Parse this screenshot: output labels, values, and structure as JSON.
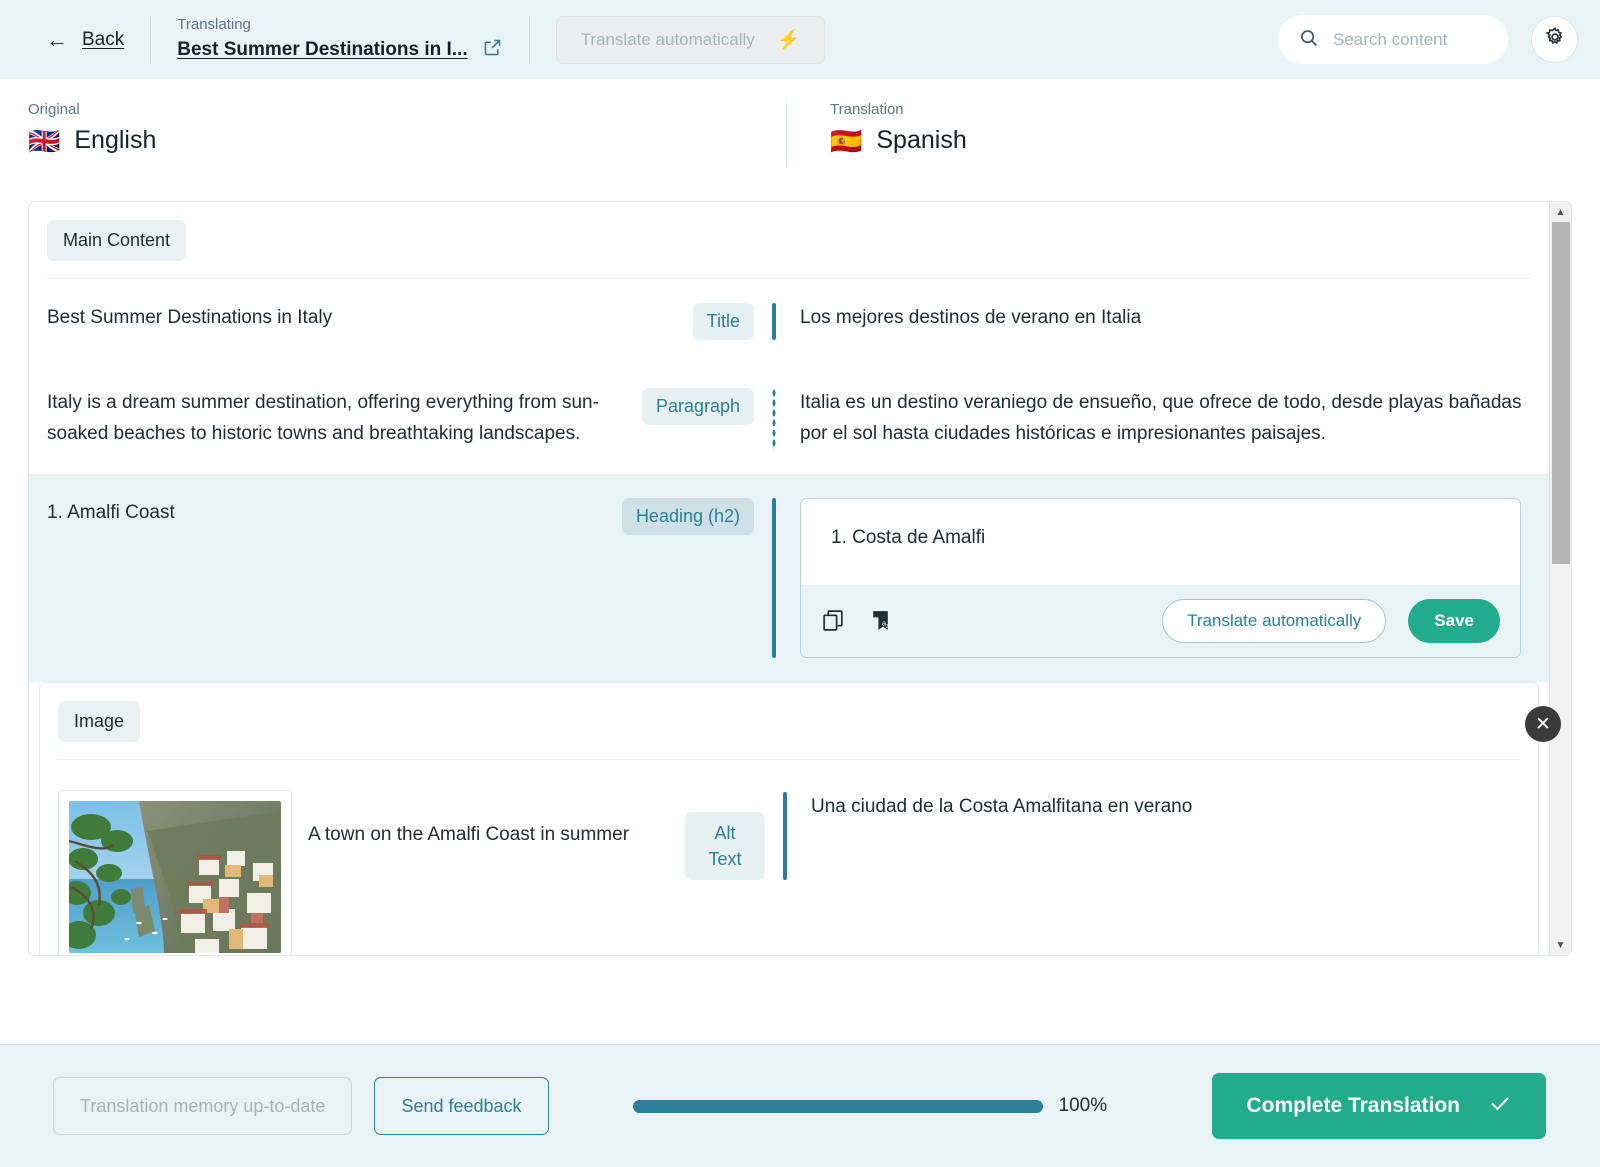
{
  "header": {
    "back_label": "Back",
    "translating_label": "Translating",
    "doc_title": "Best Summer Destinations in I...",
    "auto_translate_label": "Translate automatically",
    "search_placeholder": "Search content"
  },
  "languages": {
    "original_caption": "Original",
    "original_name": "English",
    "original_flag": "🇬🇧",
    "translation_caption": "Translation",
    "translation_name": "Spanish",
    "translation_flag": "🇪🇸"
  },
  "sections": [
    {
      "label": "Main Content"
    },
    {
      "label": "Image"
    }
  ],
  "rows": [
    {
      "source": "Best Summer Destinations in Italy",
      "badge": "Title",
      "target": "Los mejores destinos de verano en Italia"
    },
    {
      "source": "Italy is a dream summer destination, offering everything from sun-soaked beaches to historic towns and breathtaking landscapes.",
      "badge": "Paragraph",
      "target": "Italia es un destino veraniego de ensueño, que ofrece de todo, desde playas bañadas por el sol hasta ciudades históricas e impresionantes paisajes."
    },
    {
      "source": "1. Amalfi Coast",
      "badge": "Heading (h2)",
      "target": "1. Costa de Amalfi"
    },
    {
      "source": "A town on the Amalfi Coast in summer",
      "badge_line1": "Alt",
      "badge_line2": "Text",
      "target": "Una ciudad de la Costa Amalfitana en verano"
    }
  ],
  "editor": {
    "value": "1. Costa de Amalfi",
    "translate_label": "Translate automatically",
    "save_label": "Save"
  },
  "footer": {
    "memory_label": "Translation memory up-to-date",
    "feedback_label": "Send feedback",
    "progress_percent": "100%",
    "progress_value": 100,
    "complete_label": "Complete Translation"
  },
  "colors": {
    "accent_teal": "#2b7f96",
    "accent_green": "#22ab8d",
    "page_bg": "#e9f2f4"
  }
}
